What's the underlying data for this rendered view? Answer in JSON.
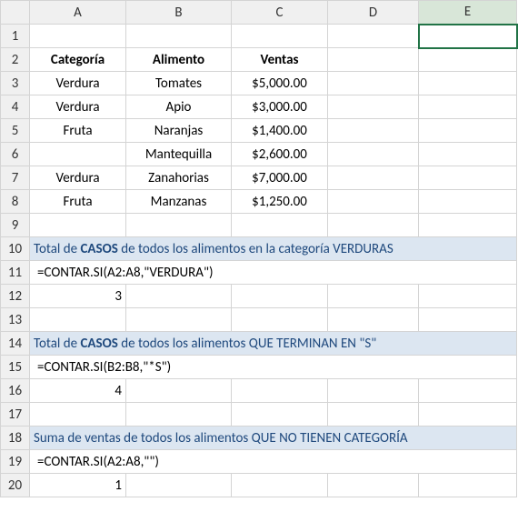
{
  "columns": [
    "A",
    "B",
    "C",
    "D",
    "E"
  ],
  "rows": [
    "1",
    "2",
    "3",
    "4",
    "5",
    "6",
    "7",
    "8",
    "9",
    "10",
    "11",
    "12",
    "13",
    "14",
    "15",
    "16",
    "17",
    "18",
    "19",
    "20"
  ],
  "selected_column": "E",
  "table": {
    "headers": {
      "categoria": "Categoría",
      "alimento": "Alimento",
      "ventas": "Ventas"
    },
    "rows": [
      {
        "categoria": "Verdura",
        "alimento": "Tomates",
        "ventas": "$5,000.00"
      },
      {
        "categoria": "Verdura",
        "alimento": "Apio",
        "ventas": "$3,000.00"
      },
      {
        "categoria": "Fruta",
        "alimento": "Naranjas",
        "ventas": "$1,400.00"
      },
      {
        "categoria": "",
        "alimento": "Mantequilla",
        "ventas": "$2,600.00"
      },
      {
        "categoria": "Verdura",
        "alimento": "Zanahorias",
        "ventas": "$7,000.00"
      },
      {
        "categoria": "Fruta",
        "alimento": "Manzanas",
        "ventas": "$1,250.00"
      }
    ]
  },
  "sections": [
    {
      "banner_pre": "Total de ",
      "banner_strong": "CASOS",
      "banner_post": " de todos los alimentos en la categoría VERDURAS",
      "formula": "=CONTAR.SI(A2:A8,\"VERDURA\")",
      "result": "3"
    },
    {
      "banner_pre": "Total de ",
      "banner_strong": "CASOS",
      "banner_post": " de todos los alimentos QUE TERMINAN EN \"S\"",
      "formula": "=CONTAR.SI(B2:B8,\"*S\")",
      "result": "4"
    },
    {
      "banner_pre": "",
      "banner_strong": "",
      "banner_post": "Suma de ventas de todos los alimentos QUE NO TIENEN CATEGORÍA",
      "formula": "=CONTAR.SI(A2:A8,\"\")",
      "result": "1"
    }
  ],
  "chart_data": {
    "type": "table",
    "title": "",
    "columns": [
      "Categoría",
      "Alimento",
      "Ventas"
    ],
    "rows": [
      [
        "Verdura",
        "Tomates",
        5000.0
      ],
      [
        "Verdura",
        "Apio",
        3000.0
      ],
      [
        "Fruta",
        "Naranjas",
        1400.0
      ],
      [
        "",
        "Mantequilla",
        2600.0
      ],
      [
        "Verdura",
        "Zanahorias",
        7000.0
      ],
      [
        "Fruta",
        "Manzanas",
        1250.0
      ]
    ],
    "formulas": [
      {
        "label": "Total de CASOS de todos los alimentos en la categoría VERDURAS",
        "formula": "=CONTAR.SI(A2:A8,\"VERDURA\")",
        "result": 3
      },
      {
        "label": "Total de CASOS de todos los alimentos QUE TERMINAN EN \"S\"",
        "formula": "=CONTAR.SI(B2:B8,\"*S\")",
        "result": 4
      },
      {
        "label": "Suma de ventas de todos los alimentos QUE NO TIENEN CATEGORÍA",
        "formula": "=CONTAR.SI(A2:A8,\"\")",
        "result": 1
      }
    ]
  }
}
